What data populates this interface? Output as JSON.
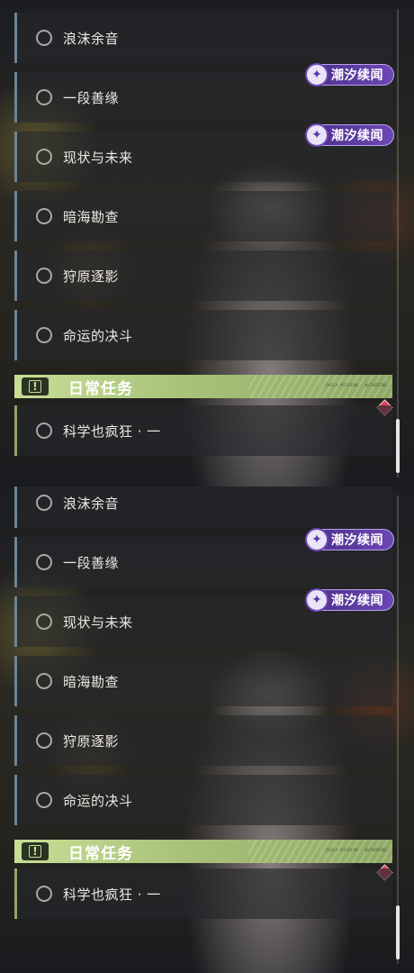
{
  "panels": [
    {
      "tasks": [
        {
          "label": "浪沫余音"
        },
        {
          "label": "一段善缘"
        },
        {
          "label": "现状与未来"
        },
        {
          "label": "暗海勘查"
        },
        {
          "label": "狩原逐影"
        },
        {
          "label": "命运的决斗"
        }
      ],
      "tags": [
        "潮汐续闻",
        "潮汐续闻"
      ],
      "daily": {
        "header_icon": "!",
        "header_title": "日常任务",
        "header_fine_print": "DAILY MISSION · WUTHERING",
        "tasks": [
          {
            "label": "科学也疯狂 · 一"
          }
        ]
      }
    },
    {
      "tasks": [
        {
          "label": "浪沫余音"
        },
        {
          "label": "一段善缘"
        },
        {
          "label": "现状与未来"
        },
        {
          "label": "暗海勘查"
        },
        {
          "label": "狩原逐影"
        },
        {
          "label": "命运的决斗"
        }
      ],
      "tags": [
        "潮汐续闻",
        "潮汐续闻"
      ],
      "daily": {
        "header_icon": "!",
        "header_title": "日常任务",
        "header_fine_print": "DAILY MISSION · WUTHERING",
        "tasks": [
          {
            "label": "科学也疯狂 · 一"
          }
        ]
      }
    }
  ],
  "icons": {
    "radio": "radio-circle-icon",
    "tag": "tide-swirl-icon",
    "header": "exclamation-icon",
    "badge": "red-diamond-icon"
  },
  "colors": {
    "row_border": "#6d8596",
    "daily_border": "#8fa76a",
    "header_bg": "#a8c27a",
    "tag_bg": "#5a3aa0",
    "badge": "#d8425a"
  }
}
